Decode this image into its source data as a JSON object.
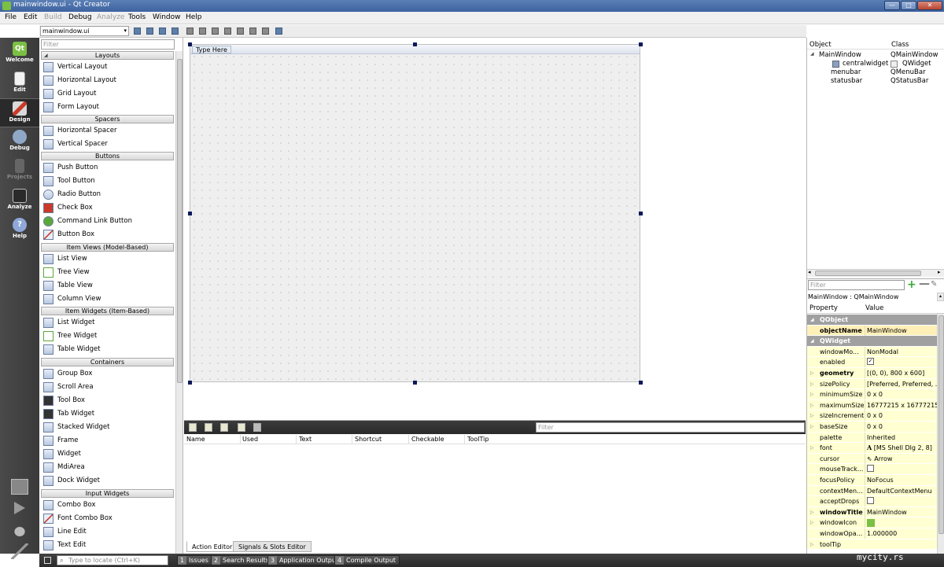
{
  "window": {
    "title": "mainwindow.ui - Qt Creator",
    "min_glyph": "—",
    "max_glyph": "□",
    "close_glyph": "✕"
  },
  "menu": [
    "File",
    "Edit",
    "Build",
    "Debug",
    "Analyze",
    "Tools",
    "Window",
    "Help"
  ],
  "modes": {
    "welcome": "Welcome",
    "edit": "Edit",
    "design": "Design",
    "debug": "Debug",
    "projects": "Projects",
    "analyze": "Analyze",
    "help": "Help",
    "qt_logo": "Qt"
  },
  "editor_toolbar": {
    "file": "mainwindow.ui",
    "arrow": "▾"
  },
  "widget_box": {
    "filter_placeholder": "Filter",
    "tri": "◢",
    "categories": {
      "layouts": "Layouts",
      "spacers": "Spacers",
      "buttons": "Buttons",
      "item_views": "Item Views (Model-Based)",
      "item_widgets": "Item Widgets (Item-Based)",
      "containers": "Containers",
      "input_widgets": "Input Widgets"
    },
    "items": {
      "vertical_layout": "Vertical Layout",
      "horizontal_layout": "Horizontal Layout",
      "grid_layout": "Grid Layout",
      "form_layout": "Form Layout",
      "horizontal_spacer": "Horizontal Spacer",
      "vertical_spacer": "Vertical Spacer",
      "push_button": "Push Button",
      "tool_button": "Tool Button",
      "radio_button": "Radio Button",
      "check_box": "Check Box",
      "command_link_button": "Command Link Button",
      "button_box": "Button Box",
      "list_view": "List View",
      "tree_view": "Tree View",
      "table_view": "Table View",
      "column_view": "Column View",
      "list_widget": "List Widget",
      "tree_widget": "Tree Widget",
      "table_widget": "Table Widget",
      "group_box": "Group Box",
      "scroll_area": "Scroll Area",
      "tool_box": "Tool Box",
      "tab_widget": "Tab Widget",
      "stacked_widget": "Stacked Widget",
      "frame": "Frame",
      "widget": "Widget",
      "mdi_area": "MdiArea",
      "dock_widget": "Dock Widget",
      "combo_box": "Combo Box",
      "font_combo_box": "Font Combo Box",
      "line_edit": "Line Edit",
      "text_edit": "Text Edit"
    }
  },
  "form": {
    "type_here": "Type Here"
  },
  "action_editor": {
    "filter_placeholder": "Filter",
    "columns": [
      "Name",
      "Used",
      "Text",
      "Shortcut",
      "Checkable",
      "ToolTip"
    ],
    "tabs": {
      "action_editor": "Action Editor",
      "signals_slots": "Signals & Slots Editor"
    }
  },
  "object_inspector": {
    "header_object": "Object",
    "header_class": "Class",
    "expand": "◢",
    "rows": {
      "mainwindow": {
        "name": "MainWindow",
        "cls": "QMainWindow"
      },
      "centralwidget": {
        "name": "centralwidget",
        "cls": "QWidget"
      },
      "menubar": {
        "name": "menubar",
        "cls": "QMenuBar"
      },
      "statusbar": {
        "name": "statusbar",
        "cls": "QStatusBar"
      }
    },
    "scroll_left": "◂",
    "scroll_right": "▸"
  },
  "property_editor": {
    "filter_placeholder": "Filter",
    "plus": "+",
    "minus": "—",
    "wrench": "✎",
    "class_label": "MainWindow : QMainWindow",
    "class_scroll": "▴",
    "header_property": "Property",
    "header_value": "Value",
    "collapse": "◢",
    "expand": "▷",
    "check": "✓",
    "groups": {
      "qobject": "QObject",
      "qwidget": "QWidget"
    },
    "rows": {
      "objectName": {
        "name": "objectName",
        "value": "MainWindow"
      },
      "windowModality": {
        "name": "windowMo...",
        "value": "NonModal"
      },
      "enabled": {
        "name": "enabled",
        "value": ""
      },
      "geometry": {
        "name": "geometry",
        "value": "[(0, 0), 800 x 600]"
      },
      "sizePolicy": {
        "name": "sizePolicy",
        "value": "[Preferred, Preferred, ..."
      },
      "minimumSize": {
        "name": "minimumSize",
        "value": "0 x 0"
      },
      "maximumSize": {
        "name": "maximumSize",
        "value": "16777215 x 16777215"
      },
      "sizeIncrement": {
        "name": "sizeIncrement",
        "value": "0 x 0"
      },
      "baseSize": {
        "name": "baseSize",
        "value": "0 x 0"
      },
      "palette": {
        "name": "palette",
        "value": "Inherited"
      },
      "font": {
        "name": "font",
        "value": "[MS Shell Dlg 2, 8]"
      },
      "cursor": {
        "name": "cursor",
        "value": "Arrow"
      },
      "mouseTracking": {
        "name": "mouseTrack...",
        "value": ""
      },
      "focusPolicy": {
        "name": "focusPolicy",
        "value": "NoFocus"
      },
      "contextMenu": {
        "name": "contextMen...",
        "value": "DefaultContextMenu"
      },
      "acceptDrops": {
        "name": "acceptDrops",
        "value": ""
      },
      "windowTitle": {
        "name": "windowTitle",
        "value": "MainWindow"
      },
      "windowIcon": {
        "name": "windowIcon",
        "value": ""
      },
      "windowOpacity": {
        "name": "windowOpa...",
        "value": "1.000000"
      },
      "toolTip": {
        "name": "toolTip",
        "value": ""
      }
    },
    "font_glyph": "A",
    "cursor_glyph": "⇖"
  },
  "status_bar": {
    "locate_placeholder": "Type to locate (Ctrl+K)",
    "mag": "⌕",
    "tabs": {
      "issues": {
        "num": "1",
        "label": "Issues"
      },
      "search": {
        "num": "2",
        "label": "Search Results"
      },
      "app_output": {
        "num": "3",
        "label": "Application Output"
      },
      "compile": {
        "num": "4",
        "label": "Compile Output"
      }
    },
    "watermark": "mycity.rs"
  }
}
